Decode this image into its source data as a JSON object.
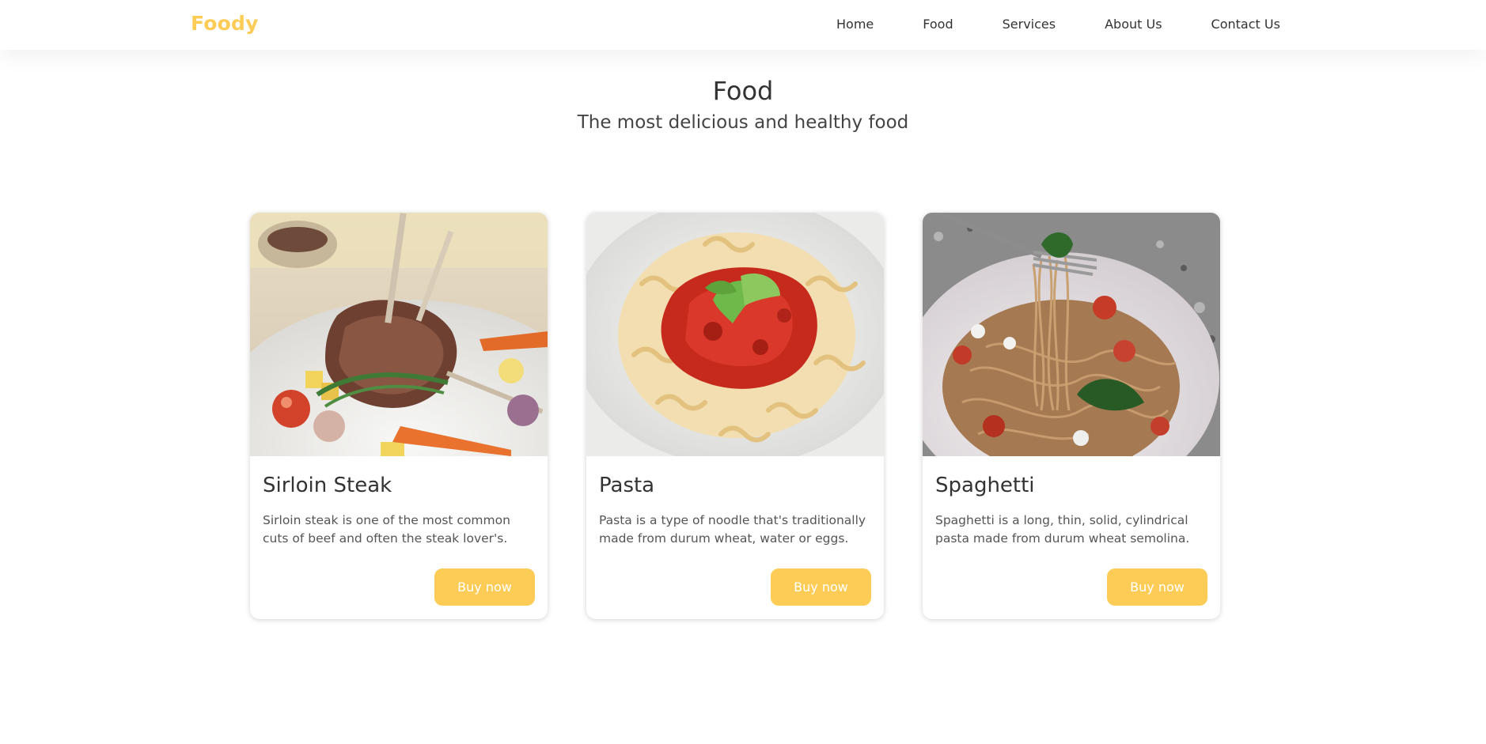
{
  "header": {
    "logo": "Foody",
    "nav": [
      "Home",
      "Food",
      "Services",
      "About Us",
      "Contact Us"
    ]
  },
  "section": {
    "title": "Food",
    "subtitle": "The most delicious and healthy food"
  },
  "cards": [
    {
      "title": "Sirloin Steak",
      "description": "Sirloin steak is one of the most common cuts of beef and often the steak lover's.",
      "button": "Buy now",
      "image": "lamb-chops-with-vegetables"
    },
    {
      "title": "Pasta",
      "description": "Pasta is a type of noodle that's traditionally made from durum wheat, water or eggs.",
      "button": "Buy now",
      "image": "fusilli-with-tomato-sauce"
    },
    {
      "title": "Spaghetti",
      "description": "Spaghetti is a long, thin, solid, cylindrical pasta made from durum wheat semolina.",
      "button": "Buy now",
      "image": "spaghetti-on-fork"
    }
  ],
  "colors": {
    "accent": "#fdcc57",
    "text": "#333333",
    "background": "#ffffff"
  }
}
